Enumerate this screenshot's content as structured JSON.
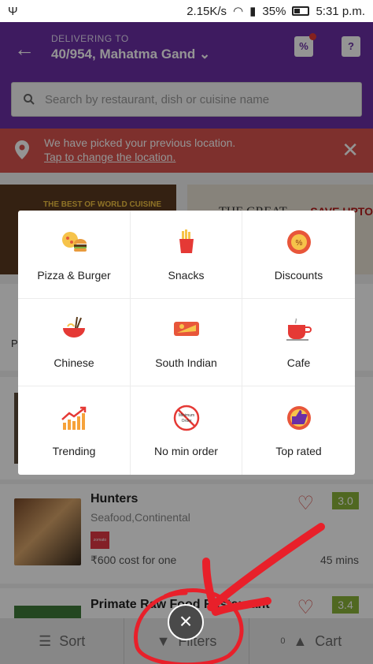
{
  "status_bar": {
    "speed": "2.15K/s",
    "battery": "35%",
    "time": "5:31 p.m."
  },
  "header": {
    "delivering_label": "DELIVERING TO",
    "address": "40/954, Mahatma Gand",
    "offers_glyph": "%",
    "help_glyph": "?"
  },
  "search": {
    "placeholder": "Search by restaurant, dish or cuisine name"
  },
  "location_banner": {
    "message": "We have picked your previous location.",
    "link": "Tap to change the location."
  },
  "promos": {
    "left_text": "THE BEST OF WORLD CUISINE",
    "right_text_1": "THE GREAT",
    "right_text_2": "SAVE UPTO"
  },
  "filter_modal": {
    "items": [
      {
        "label": "Pizza & Burger",
        "icon": "pizza-burger-icon"
      },
      {
        "label": "Snacks",
        "icon": "fries-icon"
      },
      {
        "label": "Discounts",
        "icon": "discount-icon"
      },
      {
        "label": "Chinese",
        "icon": "noodle-bowl-icon"
      },
      {
        "label": "South Indian",
        "icon": "dosa-icon"
      },
      {
        "label": "Cafe",
        "icon": "coffee-cup-icon"
      },
      {
        "label": "Trending",
        "icon": "trending-chart-icon"
      },
      {
        "label": "No min order",
        "icon": "no-minimum-order-icon"
      },
      {
        "label": "Top rated",
        "icon": "thumbs-up-icon"
      }
    ],
    "no_min_badge": "Minimum Order"
  },
  "restaurants": [
    {
      "name": "Hunters",
      "cuisine": "Seafood,Continental",
      "cost": "₹600 cost for one",
      "time": "45 mins",
      "rating": "3.0",
      "badge": "zomato"
    },
    {
      "name": "Primate Raw Food Restaurant",
      "rating": "3.4"
    }
  ],
  "bottom_bar": {
    "sort": "Sort",
    "filters": "Filters",
    "cart": "Cart",
    "cart_count": "0"
  },
  "colors": {
    "header": "#6b2fa6",
    "banner": "#d9534f",
    "rating": "#8bb33a",
    "annotation": "#e8202a"
  }
}
